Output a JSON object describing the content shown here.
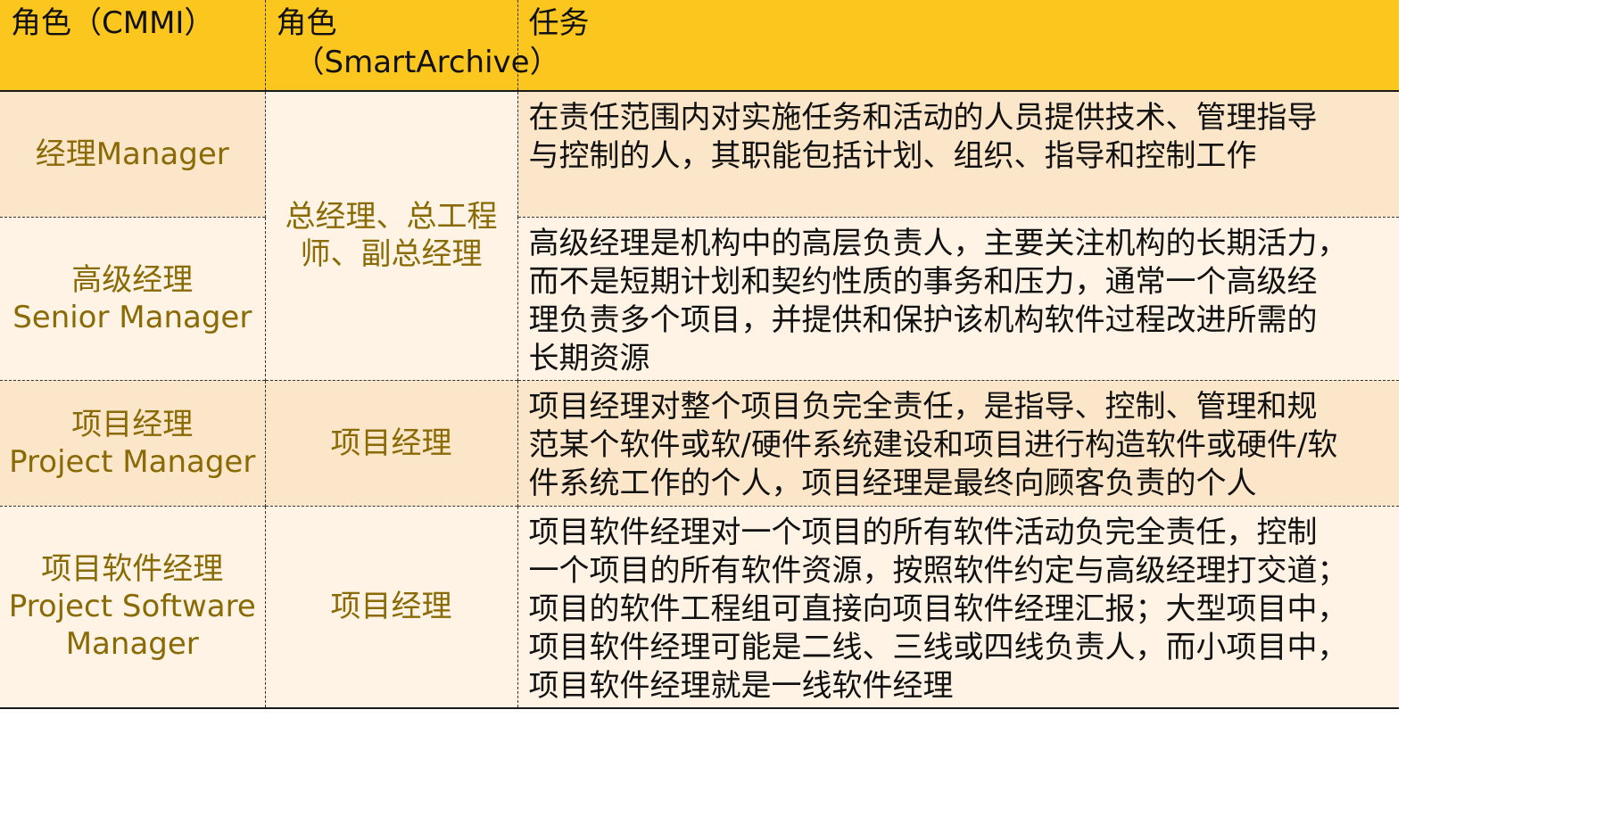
{
  "table": {
    "headers": {
      "col1": "角色（CMMI）",
      "col2_line1": "角色",
      "col2_line2": "（SmartArchive）",
      "col3": "任务"
    },
    "rows": [
      {
        "cmmi_role": [
          "经理Manager"
        ],
        "smartarchive_role": [
          "总经理、总工程",
          "师、副总经理"
        ],
        "task": [
          "在责任范围内对实施任务和活动的人员提供技术、管理指导",
          "与控制的人，其职能包括计划、组织、指导和控制工作"
        ]
      },
      {
        "cmmi_role": [
          "高级经理",
          "Senior Manager"
        ],
        "task": [
          "高级经理是机构中的高层负责人，主要关注机构的长期活力，",
          "而不是短期计划和契约性质的事务和压力，通常一个高级经",
          "理负责多个项目，并提供和保护该机构软件过程改进所需的",
          "长期资源"
        ]
      },
      {
        "cmmi_role": [
          "项目经理",
          "Project Manager"
        ],
        "smartarchive_role": [
          "项目经理"
        ],
        "task": [
          "项目经理对整个项目负完全责任，是指导、控制、管理和规",
          "范某个软件或软/硬件系统建设和项目进行构造软件或硬件/软",
          "件系统工作的个人，项目经理是最终向顾客负责的个人"
        ]
      },
      {
        "cmmi_role": [
          "项目软件经理",
          "Project Software",
          "Manager"
        ],
        "smartarchive_role": [
          "项目经理"
        ],
        "task": [
          "项目软件经理对一个项目的所有软件活动负完全责任，控制",
          "一个项目的所有软件资源，按照软件约定与高级经理打交道；",
          "项目的软件工程组可直接向项目软件经理汇报；大型项目中，",
          "项目软件经理可能是二线、三线或四线负责人，而小项目中，",
          "项目软件经理就是一线软件经理"
        ]
      }
    ]
  },
  "colors": {
    "header_bg": "#FBC71E",
    "row_alt_bg": "#FCE6C9",
    "row_light_bg": "#FEF3E4",
    "role_text": "#8A6A05"
  }
}
